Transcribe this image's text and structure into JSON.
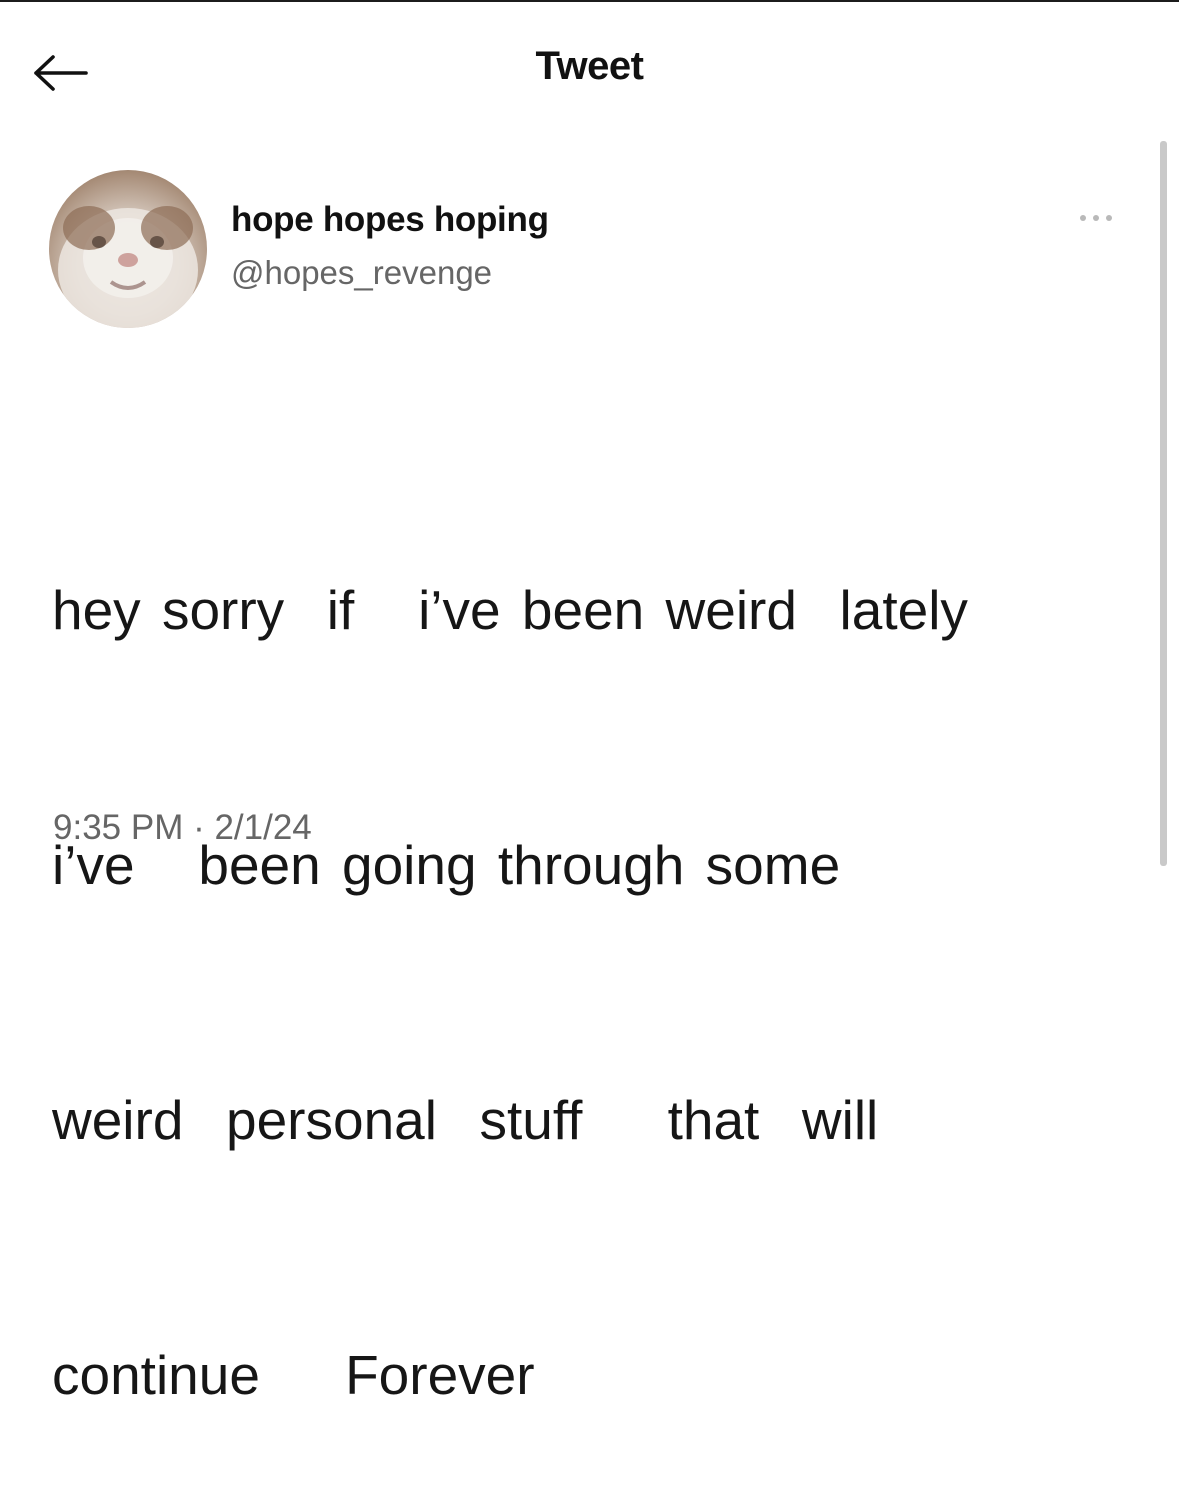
{
  "header": {
    "title": "Tweet",
    "back_icon": "arrow-left-icon"
  },
  "author": {
    "display_name": "hope hopes hoping",
    "handle": "@hopes_revenge",
    "avatar": "hamster-avatar-photo"
  },
  "menu": {
    "more_icon": "more-horizontal-icon"
  },
  "tweet": {
    "lines": [
      "hey sorry  if   i’ve been weird  lately",
      "i’ve   been going through some",
      "weird  personal  stuff    that  will",
      "continue    Forever"
    ],
    "timestamp": "9:35 PM · 2/1/24"
  },
  "colors": {
    "text_primary": "#111111",
    "text_secondary": "#666666",
    "scrollbar": "#c9c9c9"
  }
}
